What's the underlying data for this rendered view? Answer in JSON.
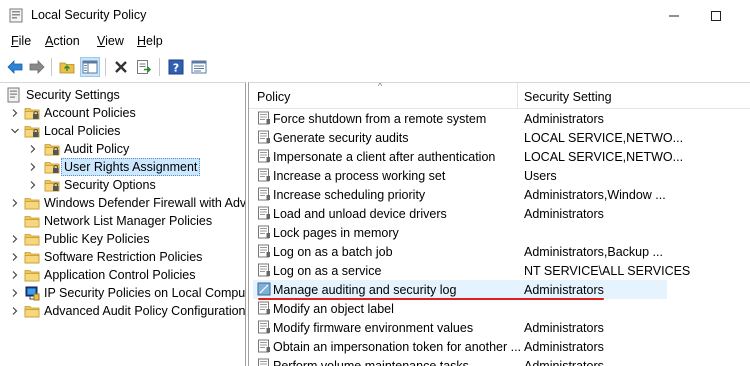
{
  "window": {
    "title": "Local Security Policy"
  },
  "menu": {
    "items": [
      {
        "label": "File",
        "accel": "F",
        "rest": "ile"
      },
      {
        "label": "Action",
        "accel": "A",
        "rest": "ction"
      },
      {
        "label": "View",
        "accel": "V",
        "rest": "iew"
      },
      {
        "label": "Help",
        "accel": "H",
        "rest": "elp"
      }
    ]
  },
  "toolbar": {
    "buttons": [
      "back-icon",
      "forward-icon",
      "up-folder-icon",
      "show-hide-tree-icon",
      "delete-icon",
      "export-list-icon",
      "help-icon",
      "properties-icon"
    ]
  },
  "tree": {
    "items": [
      {
        "label": "Security Settings",
        "level": 0,
        "expanded": true
      },
      {
        "label": "Account Policies",
        "level": 1,
        "expanded": false
      },
      {
        "label": "Local Policies",
        "level": 1,
        "expanded": true
      },
      {
        "label": "Audit Policy",
        "level": 2,
        "expanded": false
      },
      {
        "label": "User Rights Assignment",
        "level": 2,
        "expanded": false,
        "selected": true
      },
      {
        "label": "Security Options",
        "level": 2,
        "expanded": false
      },
      {
        "label": "Windows Defender Firewall with Adva",
        "level": 1,
        "expanded": false
      },
      {
        "label": "Network List Manager Policies",
        "level": 1
      },
      {
        "label": "Public Key Policies",
        "level": 1,
        "expanded": false
      },
      {
        "label": "Software Restriction Policies",
        "level": 1,
        "expanded": false
      },
      {
        "label": "Application Control Policies",
        "level": 1,
        "expanded": false
      },
      {
        "label": "IP Security Policies on Local Compute",
        "level": 1,
        "expanded": false
      },
      {
        "label": "Advanced Audit Policy Configuration",
        "level": 1,
        "expanded": false
      }
    ]
  },
  "list": {
    "columns": {
      "policy": "Policy",
      "setting": "Security Setting"
    },
    "rows": [
      {
        "policy": "Force shutdown from a remote system",
        "setting": "Administrators"
      },
      {
        "policy": "Generate security audits",
        "setting": "LOCAL SERVICE,NETWO..."
      },
      {
        "policy": "Impersonate a client after authentication",
        "setting": "LOCAL SERVICE,NETWO..."
      },
      {
        "policy": "Increase a process working set",
        "setting": "Users"
      },
      {
        "policy": "Increase scheduling priority",
        "setting": "Administrators,Window ..."
      },
      {
        "policy": "Load and unload device drivers",
        "setting": "Administrators"
      },
      {
        "policy": "Lock pages in memory",
        "setting": ""
      },
      {
        "policy": "Log on as a batch job",
        "setting": "Administrators,Backup ..."
      },
      {
        "policy": "Log on as a service",
        "setting": "NT SERVICE\\ALL SERVICES"
      },
      {
        "policy": "Manage auditing and security log",
        "setting": "Administrators",
        "highlighted": true
      },
      {
        "policy": "Modify an object label",
        "setting": ""
      },
      {
        "policy": "Modify firmware environment values",
        "setting": "Administrators"
      },
      {
        "policy": "Obtain an impersonation token for another ...",
        "setting": "Administrators"
      },
      {
        "policy": "Perform volume maintenance tasks",
        "setting": "Administrators"
      }
    ]
  },
  "colors": {
    "selection": "#cce8ff",
    "hover_row": "#e5f3ff",
    "annotation_underline": "#e0201c",
    "accent": "#1e73be"
  }
}
